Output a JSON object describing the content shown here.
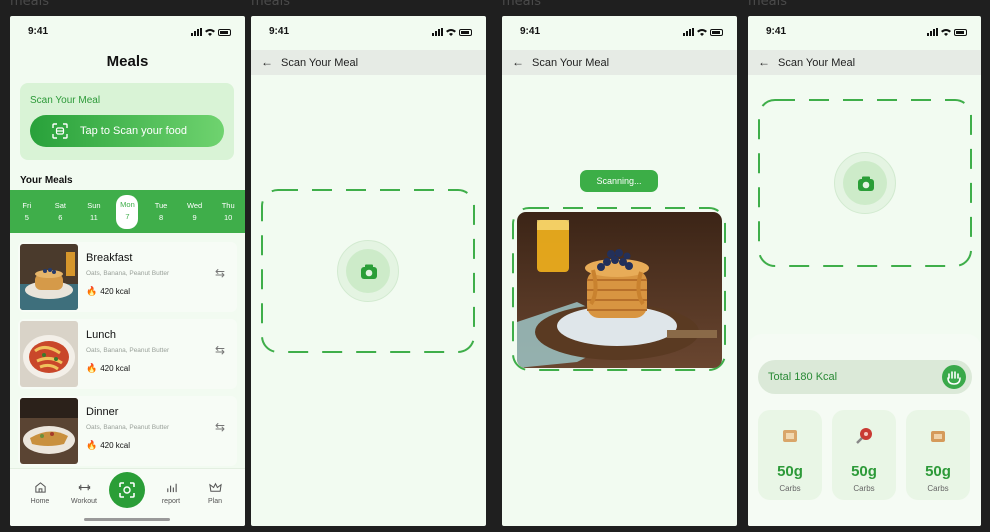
{
  "frame_labels": [
    "meals",
    "meals",
    "meals",
    "meals"
  ],
  "status": {
    "time": "9:41"
  },
  "screen1": {
    "title": "Meals",
    "scan_card": {
      "label": "Scan Your Meal",
      "button": "Tap to Scan your food"
    },
    "section": "Your Meals",
    "days": [
      {
        "name": "Fri",
        "num": "5"
      },
      {
        "name": "Sat",
        "num": "6"
      },
      {
        "name": "Sun",
        "num": "11"
      },
      {
        "name": "Mon",
        "num": "7"
      },
      {
        "name": "Tue",
        "num": "8"
      },
      {
        "name": "Wed",
        "num": "9"
      },
      {
        "name": "Thu",
        "num": "10"
      }
    ],
    "active_day": "Mon",
    "meals": [
      {
        "name": "Breakfast",
        "ingredients": "Oats, Banana, Peanut Butter",
        "kcal": "420 kcal"
      },
      {
        "name": "Lunch",
        "ingredients": "Oats, Banana, Peanut Butter",
        "kcal": "420 kcal"
      },
      {
        "name": "Dinner",
        "ingredients": "Oats, Banana, Peanut Butter",
        "kcal": "420 kcal"
      }
    ],
    "tabs": [
      "Home",
      "Workout",
      "report",
      "Plan"
    ]
  },
  "scan": {
    "title": "Scan Your Meal",
    "scanning_label": "Scanning..."
  },
  "result": {
    "total": "Total 180 Kcal",
    "macros": [
      {
        "value": "50g",
        "label": "Carbs"
      },
      {
        "value": "50g",
        "label": "Carbs"
      },
      {
        "value": "50g",
        "label": "Carbs"
      }
    ]
  },
  "colors": {
    "accent": "#3fae4a",
    "background": "#f2fbf1",
    "dark": "#1f1f1f"
  }
}
